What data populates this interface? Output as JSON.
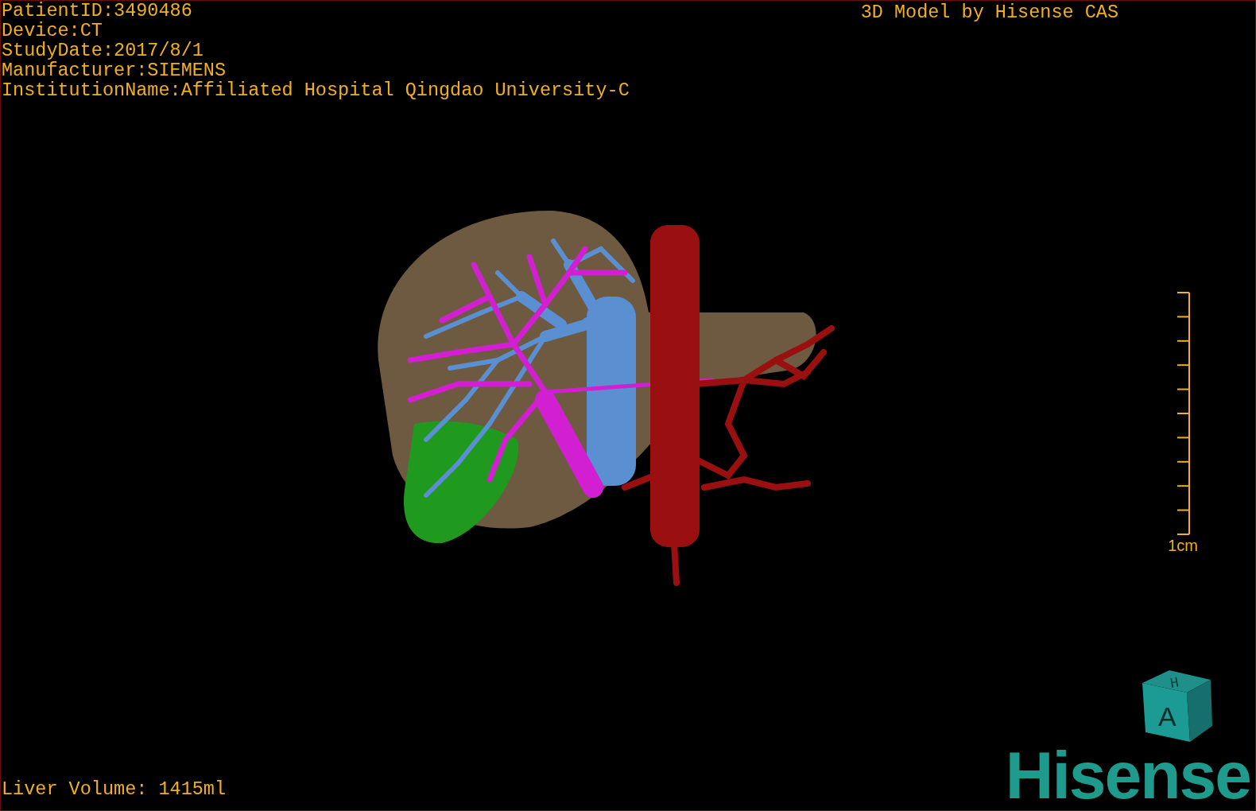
{
  "study_info": [
    "PatientID:3490486",
    "Device:CT",
    "StudyDate:2017/8/1",
    "Manufacturer:SIEMENS",
    "InstitutionName:Affiliated Hospital Qingdao University-C"
  ],
  "title": "3D Model by Hisense CAS",
  "scale_bar": {
    "label": "1cm"
  },
  "liver_volume": "Liver Volume: 1415ml",
  "orientation_cube": {
    "top_label": "H",
    "front_label": "A"
  },
  "logo": "Hisense"
}
